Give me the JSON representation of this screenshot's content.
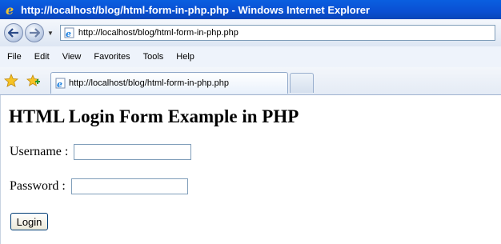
{
  "window": {
    "title": "http://localhost/blog/html-form-in-php.php - Windows Internet Explorer"
  },
  "address_bar": {
    "url": "http://localhost/blog/html-form-in-php.php"
  },
  "menu": {
    "items": [
      {
        "label": "File"
      },
      {
        "label": "Edit"
      },
      {
        "label": "View"
      },
      {
        "label": "Favorites"
      },
      {
        "label": "Tools"
      },
      {
        "label": "Help"
      }
    ]
  },
  "tab": {
    "label": "http://localhost/blog/html-form-in-php.php"
  },
  "page": {
    "heading": "HTML Login Form Example in PHP",
    "username_label": "Username : ",
    "username_value": "",
    "password_label": "Password : ",
    "password_value": "",
    "login_label": "Login"
  },
  "colors": {
    "titlebar": "#0a4fd2",
    "ie_icon": "#1a7fe0"
  }
}
